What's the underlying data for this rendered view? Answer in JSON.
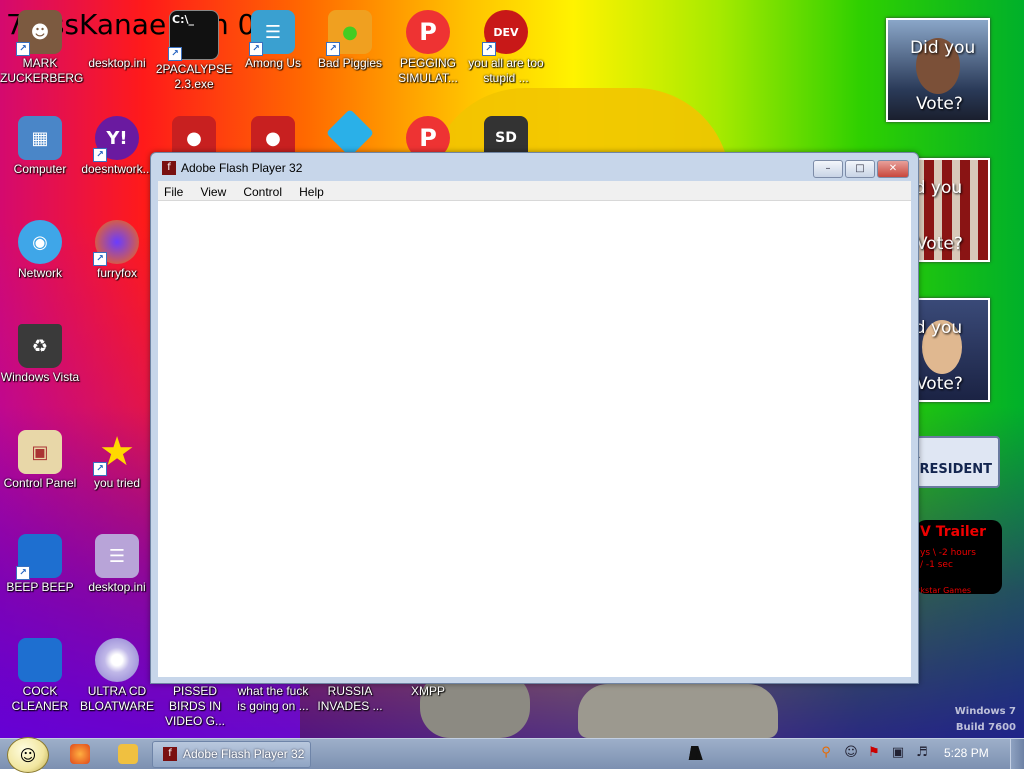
{
  "desktop": {
    "banner_text": "7 ossKanae tion 012",
    "watermark": {
      "line1": "Windows 7",
      "line2": "Build 7600"
    },
    "icons": [
      {
        "label": "MARK ZUCKERBERG",
        "icon": "person-icon"
      },
      {
        "label": "desktop.ini",
        "icon": "file-icon"
      },
      {
        "label": "2PACALYPSE 2.3.exe",
        "icon": "terminal-icon"
      },
      {
        "label": "Among Us",
        "icon": "game-icon"
      },
      {
        "label": "Bad Piggies",
        "icon": "pig-icon"
      },
      {
        "label": "PEGGING SIMULAT...",
        "icon": "p-logo-icon"
      },
      {
        "label": "you all are too stupid ...",
        "icon": "devcpp-icon"
      },
      {
        "label": "Computer",
        "icon": "computer-icon"
      },
      {
        "label": "doesntwork...",
        "icon": "yahoo-icon"
      },
      {
        "label": "Network",
        "icon": "network-icon"
      },
      {
        "label": "furryfox",
        "icon": "firefox-icon"
      },
      {
        "label": "Windows Vista",
        "icon": "recycle-bin-icon"
      },
      {
        "label": "Control Panel",
        "icon": "control-panel-icon"
      },
      {
        "label": "you tried",
        "icon": "star-icon"
      },
      {
        "label": "BEEP BEEP",
        "icon": "blue-app-icon"
      },
      {
        "label": "desktop.ini",
        "icon": "document-icon"
      },
      {
        "label": "COCK CLEANER",
        "icon": "blue-app-icon"
      },
      {
        "label": "ULTRA CD BLOATWARE",
        "icon": "cd-icon"
      },
      {
        "label": "PISSED BIRDS IN VIDEO G...",
        "icon": "angry-bird-icon"
      },
      {
        "label": "what the fuck is going on ...",
        "icon": "angry-bird-icon"
      },
      {
        "label": "RUSSIA INVADES ...",
        "icon": "diamond-icon"
      },
      {
        "label": "XMPP",
        "icon": "p-logo-icon"
      }
    ],
    "gadgets": {
      "vote1": {
        "line1": "Did you",
        "line2": "Vote?"
      },
      "vote2": {
        "line1": "id you",
        "line2": "Vote?"
      },
      "vote3": {
        "line1": "id you",
        "line2": "Vote?"
      },
      "president": "R PRESIDENT",
      "trailer": {
        "title": "V Trailer",
        "line1": "ys \\ -2 hours",
        "line2": "/ -1 sec",
        "footer": "ckstar Games"
      }
    }
  },
  "window": {
    "title": "Adobe Flash Player 32",
    "menu": [
      "File",
      "View",
      "Control",
      "Help"
    ],
    "controls": {
      "minimize": "–",
      "maximize": "□",
      "close": "✕"
    }
  },
  "taskbar": {
    "start_glyph": "☺",
    "task_label": "Adobe Flash Player 32",
    "clock": "5:28 PM",
    "colors": {
      "firefox": "#e8681c",
      "folder": "#f0c040",
      "flash": "#7a1010"
    }
  }
}
